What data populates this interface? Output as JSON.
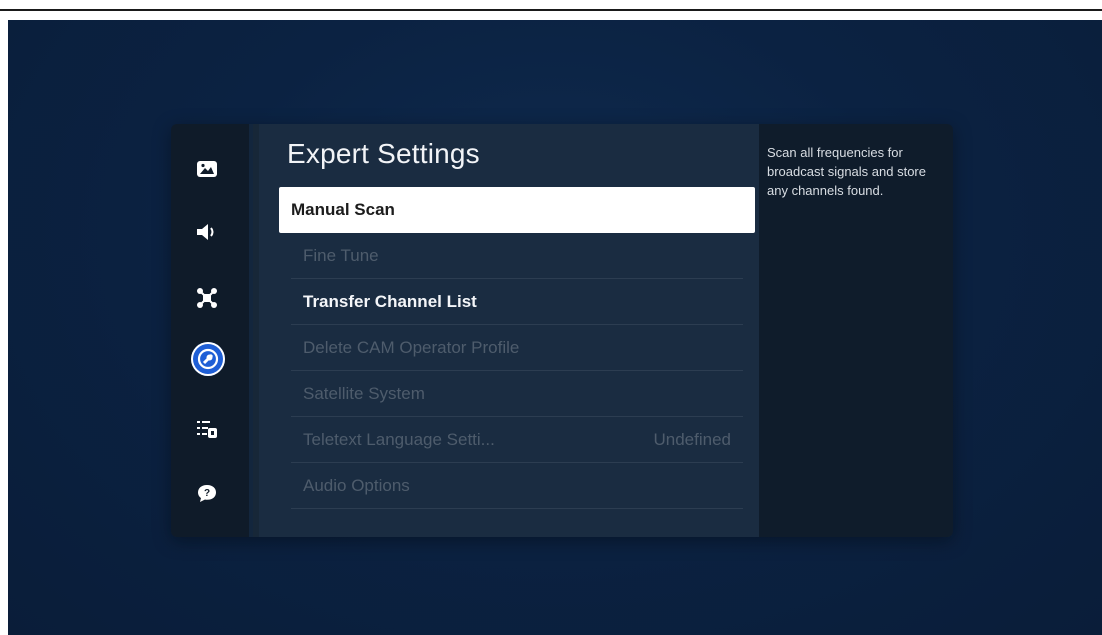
{
  "menu": {
    "title": "Expert Settings",
    "items": [
      {
        "label": "Manual Scan",
        "state": "selected"
      },
      {
        "label": "Fine Tune",
        "state": "disabled"
      },
      {
        "label": "Transfer Channel List",
        "state": "enabled"
      },
      {
        "label": "Delete CAM Operator Profile",
        "state": "disabled"
      },
      {
        "label": "Satellite System",
        "state": "disabled"
      },
      {
        "label": "Teletext Language Setti...",
        "value": "Undefined",
        "state": "disabled"
      },
      {
        "label": "Audio Options",
        "state": "disabled"
      }
    ]
  },
  "sidebar": {
    "icons": [
      {
        "name": "picture-icon"
      },
      {
        "name": "sound-icon"
      },
      {
        "name": "connection-icon"
      },
      {
        "name": "broadcasting-icon",
        "active": true
      },
      {
        "name": "general-icon"
      },
      {
        "name": "support-icon"
      }
    ]
  },
  "description": {
    "text": "Scan all frequencies for broadcast signals and store any channels found."
  },
  "colors": {
    "background": "#0b2242",
    "panel": "#1a2c41",
    "rail": "#0f1b29",
    "selected": "#ffffff",
    "active_icon": "#1f5fd6",
    "disabled_text": "#4e5c6c"
  }
}
